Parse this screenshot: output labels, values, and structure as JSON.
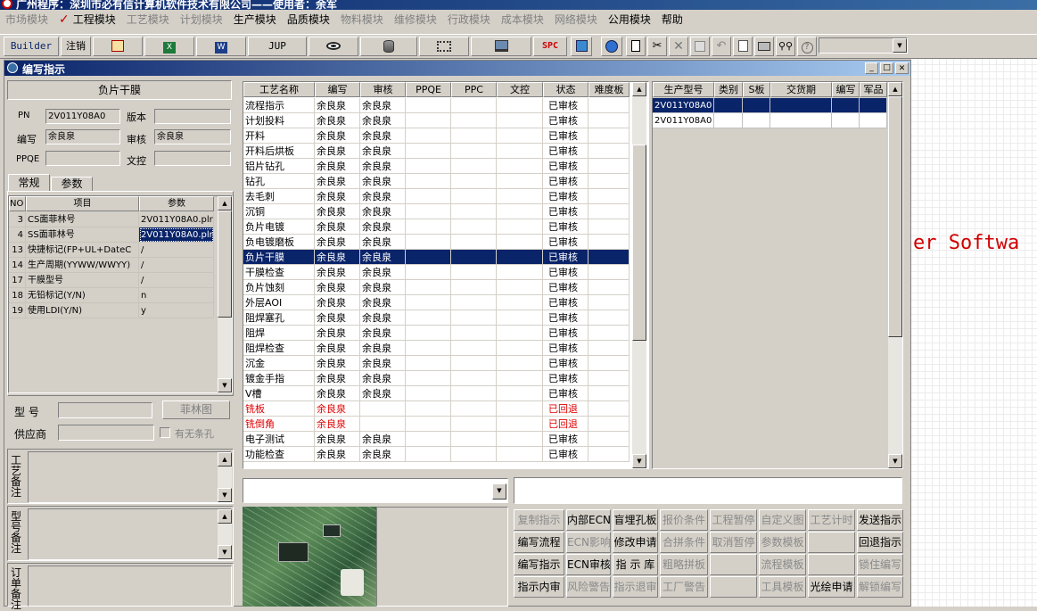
{
  "title_bar": {
    "text": "广州程序：深圳市必有信计算机软件技术有限公司——使用者：余军"
  },
  "menu": [
    {
      "label": "市场模块",
      "enabled": false
    },
    {
      "label": "✓",
      "enabled": true,
      "check": true
    },
    {
      "label": "工程模块",
      "enabled": true
    },
    {
      "label": "工艺模块",
      "enabled": false
    },
    {
      "label": "计划模块",
      "enabled": false
    },
    {
      "label": "生产模块",
      "enabled": true
    },
    {
      "label": "品质模块",
      "enabled": true
    },
    {
      "label": "物料模块",
      "enabled": false
    },
    {
      "label": "维修模块",
      "enabled": false
    },
    {
      "label": "行政模块",
      "enabled": false
    },
    {
      "label": "成本模块",
      "enabled": false
    },
    {
      "label": "网络模块",
      "enabled": false
    },
    {
      "label": "公用模块",
      "enabled": true
    },
    {
      "label": "帮助",
      "enabled": true
    }
  ],
  "toolbar": {
    "builder": "Builder",
    "logout": "注销",
    "jup": "JUP",
    "spc": "SPC"
  },
  "child_window": {
    "title": "编写指示"
  },
  "left": {
    "panel_title": "负片干膜",
    "pn_label": "PN",
    "pn_value": "2V011Y08A0",
    "version_label": "版本",
    "version_value": "",
    "writer_label": "编写",
    "writer_value": "余良泉",
    "review_label": "审核",
    "review_value": "余良泉",
    "ppqe_label": "PPQE",
    "ppqe_value": "",
    "wenkong_label": "文控",
    "wenkong_value": "",
    "tabs": [
      "常规",
      "参数"
    ],
    "param_headers": [
      "NO",
      "项目",
      "参数"
    ],
    "params": [
      [
        "3",
        "CS面菲林号",
        "2V011Y08A0.plr"
      ],
      [
        "4",
        "SS面菲林号",
        "2V011Y08A0.plr"
      ],
      [
        "13",
        "快捷标记(FP+UL+DateC",
        "/"
      ],
      [
        "14",
        "生产周期(YYWW/WWYY)",
        "/"
      ],
      [
        "17",
        "干膜型号",
        "/"
      ],
      [
        "18",
        "无铅标记(Y/N)",
        "n"
      ],
      [
        "19",
        "使用LDI(Y/N)",
        "y"
      ]
    ],
    "model_label": "型  号",
    "film_btn": "菲林图",
    "supplier_label": "供应商",
    "no_hole_label": "有无条孔",
    "memo1_label": "工艺备注",
    "memo2_label": "型号备注",
    "memo3_label": "订单备注"
  },
  "process": {
    "headers": [
      "工艺名称",
      "编写",
      "审核",
      "PPQE",
      "PPC",
      "文控",
      "状态",
      "难度板"
    ],
    "rows": [
      [
        "流程指示",
        "余良泉",
        "余良泉",
        "",
        "",
        "",
        "已审核",
        ""
      ],
      [
        "计划投料",
        "余良泉",
        "余良泉",
        "",
        "",
        "",
        "已审核",
        ""
      ],
      [
        "开料",
        "余良泉",
        "余良泉",
        "",
        "",
        "",
        "已审核",
        ""
      ],
      [
        "开料后烘板",
        "余良泉",
        "余良泉",
        "",
        "",
        "",
        "已审核",
        ""
      ],
      [
        "铝片钻孔",
        "余良泉",
        "余良泉",
        "",
        "",
        "",
        "已审核",
        ""
      ],
      [
        "钻孔",
        "余良泉",
        "余良泉",
        "",
        "",
        "",
        "已审核",
        ""
      ],
      [
        "去毛刺",
        "余良泉",
        "余良泉",
        "",
        "",
        "",
        "已审核",
        ""
      ],
      [
        "沉铜",
        "余良泉",
        "余良泉",
        "",
        "",
        "",
        "已审核",
        ""
      ],
      [
        "负片电镀",
        "余良泉",
        "余良泉",
        "",
        "",
        "",
        "已审核",
        ""
      ],
      [
        "负电镀磨板",
        "余良泉",
        "余良泉",
        "",
        "",
        "",
        "已审核",
        ""
      ],
      [
        "负片干膜",
        "余良泉",
        "余良泉",
        "",
        "",
        "",
        "已审核",
        ""
      ],
      [
        "干膜检查",
        "余良泉",
        "余良泉",
        "",
        "",
        "",
        "已审核",
        ""
      ],
      [
        "负片蚀刻",
        "余良泉",
        "余良泉",
        "",
        "",
        "",
        "已审核",
        ""
      ],
      [
        "外层AOI",
        "余良泉",
        "余良泉",
        "",
        "",
        "",
        "已审核",
        ""
      ],
      [
        "阻焊塞孔",
        "余良泉",
        "余良泉",
        "",
        "",
        "",
        "已审核",
        ""
      ],
      [
        "阻焊",
        "余良泉",
        "余良泉",
        "",
        "",
        "",
        "已审核",
        ""
      ],
      [
        "阻焊检查",
        "余良泉",
        "余良泉",
        "",
        "",
        "",
        "已审核",
        ""
      ],
      [
        "沉金",
        "余良泉",
        "余良泉",
        "",
        "",
        "",
        "已审核",
        ""
      ],
      [
        "镀金手指",
        "余良泉",
        "余良泉",
        "",
        "",
        "",
        "已审核",
        ""
      ],
      [
        "V槽",
        "余良泉",
        "余良泉",
        "",
        "",
        "",
        "已审核",
        ""
      ],
      [
        "铣板",
        "余良泉",
        "",
        "",
        "",
        "",
        "已回退",
        ""
      ],
      [
        "铣倒角",
        "余良泉",
        "",
        "",
        "",
        "",
        "已回退",
        ""
      ],
      [
        "电子测试",
        "余良泉",
        "余良泉",
        "",
        "",
        "",
        "已审核",
        ""
      ],
      [
        "功能检查",
        "余良泉",
        "余良泉",
        "",
        "",
        "",
        "已审核",
        ""
      ]
    ],
    "selected_index": 10,
    "returned_color": "#e00000",
    "select_color": "#0a246a"
  },
  "right_grid": {
    "headers": [
      "生产型号",
      "类别",
      "S板",
      "交货期",
      "编写",
      "军品"
    ],
    "rows": [
      [
        "2V011Y08A0",
        "",
        "",
        "",
        "",
        ""
      ],
      [
        "2V011Y08A0",
        "",
        "",
        "",
        "",
        ""
      ]
    ]
  },
  "background_text": "er Softwa",
  "action_buttons": [
    {
      "label": "复制指示",
      "enabled": false
    },
    {
      "label": "内部ECN",
      "enabled": true
    },
    {
      "label": "盲埋孔板",
      "enabled": true
    },
    {
      "label": "报价条件",
      "enabled": false
    },
    {
      "label": "工程暂停",
      "enabled": false
    },
    {
      "label": "自定义图",
      "enabled": false
    },
    {
      "label": "工艺计时",
      "enabled": false
    },
    {
      "label": "发送指示",
      "enabled": true
    },
    {
      "label": "编写流程",
      "enabled": true
    },
    {
      "label": "ECN影响",
      "enabled": false
    },
    {
      "label": "修改申请",
      "enabled": true
    },
    {
      "label": "合拼条件",
      "enabled": false
    },
    {
      "label": "取消暂停",
      "enabled": false
    },
    {
      "label": "参数模板",
      "enabled": false
    },
    {
      "label": "",
      "enabled": false
    },
    {
      "label": "回退指示",
      "enabled": true
    },
    {
      "label": "编写指示",
      "enabled": true
    },
    {
      "label": "ECN审核",
      "enabled": true
    },
    {
      "label": "指 示 库",
      "enabled": true
    },
    {
      "label": "粗略拼板",
      "enabled": false
    },
    {
      "label": "",
      "enabled": false
    },
    {
      "label": "流程模板",
      "enabled": false
    },
    {
      "label": "",
      "enabled": false
    },
    {
      "label": "锁住编写",
      "enabled": false
    },
    {
      "label": "指示内审",
      "enabled": true
    },
    {
      "label": "风险警告",
      "enabled": false
    },
    {
      "label": "指示退审",
      "enabled": false
    },
    {
      "label": "工厂警告",
      "enabled": false
    },
    {
      "label": "",
      "enabled": false
    },
    {
      "label": "工具模板",
      "enabled": false
    },
    {
      "label": "光绘申请",
      "enabled": true
    },
    {
      "label": "解锁编写",
      "enabled": false
    }
  ]
}
